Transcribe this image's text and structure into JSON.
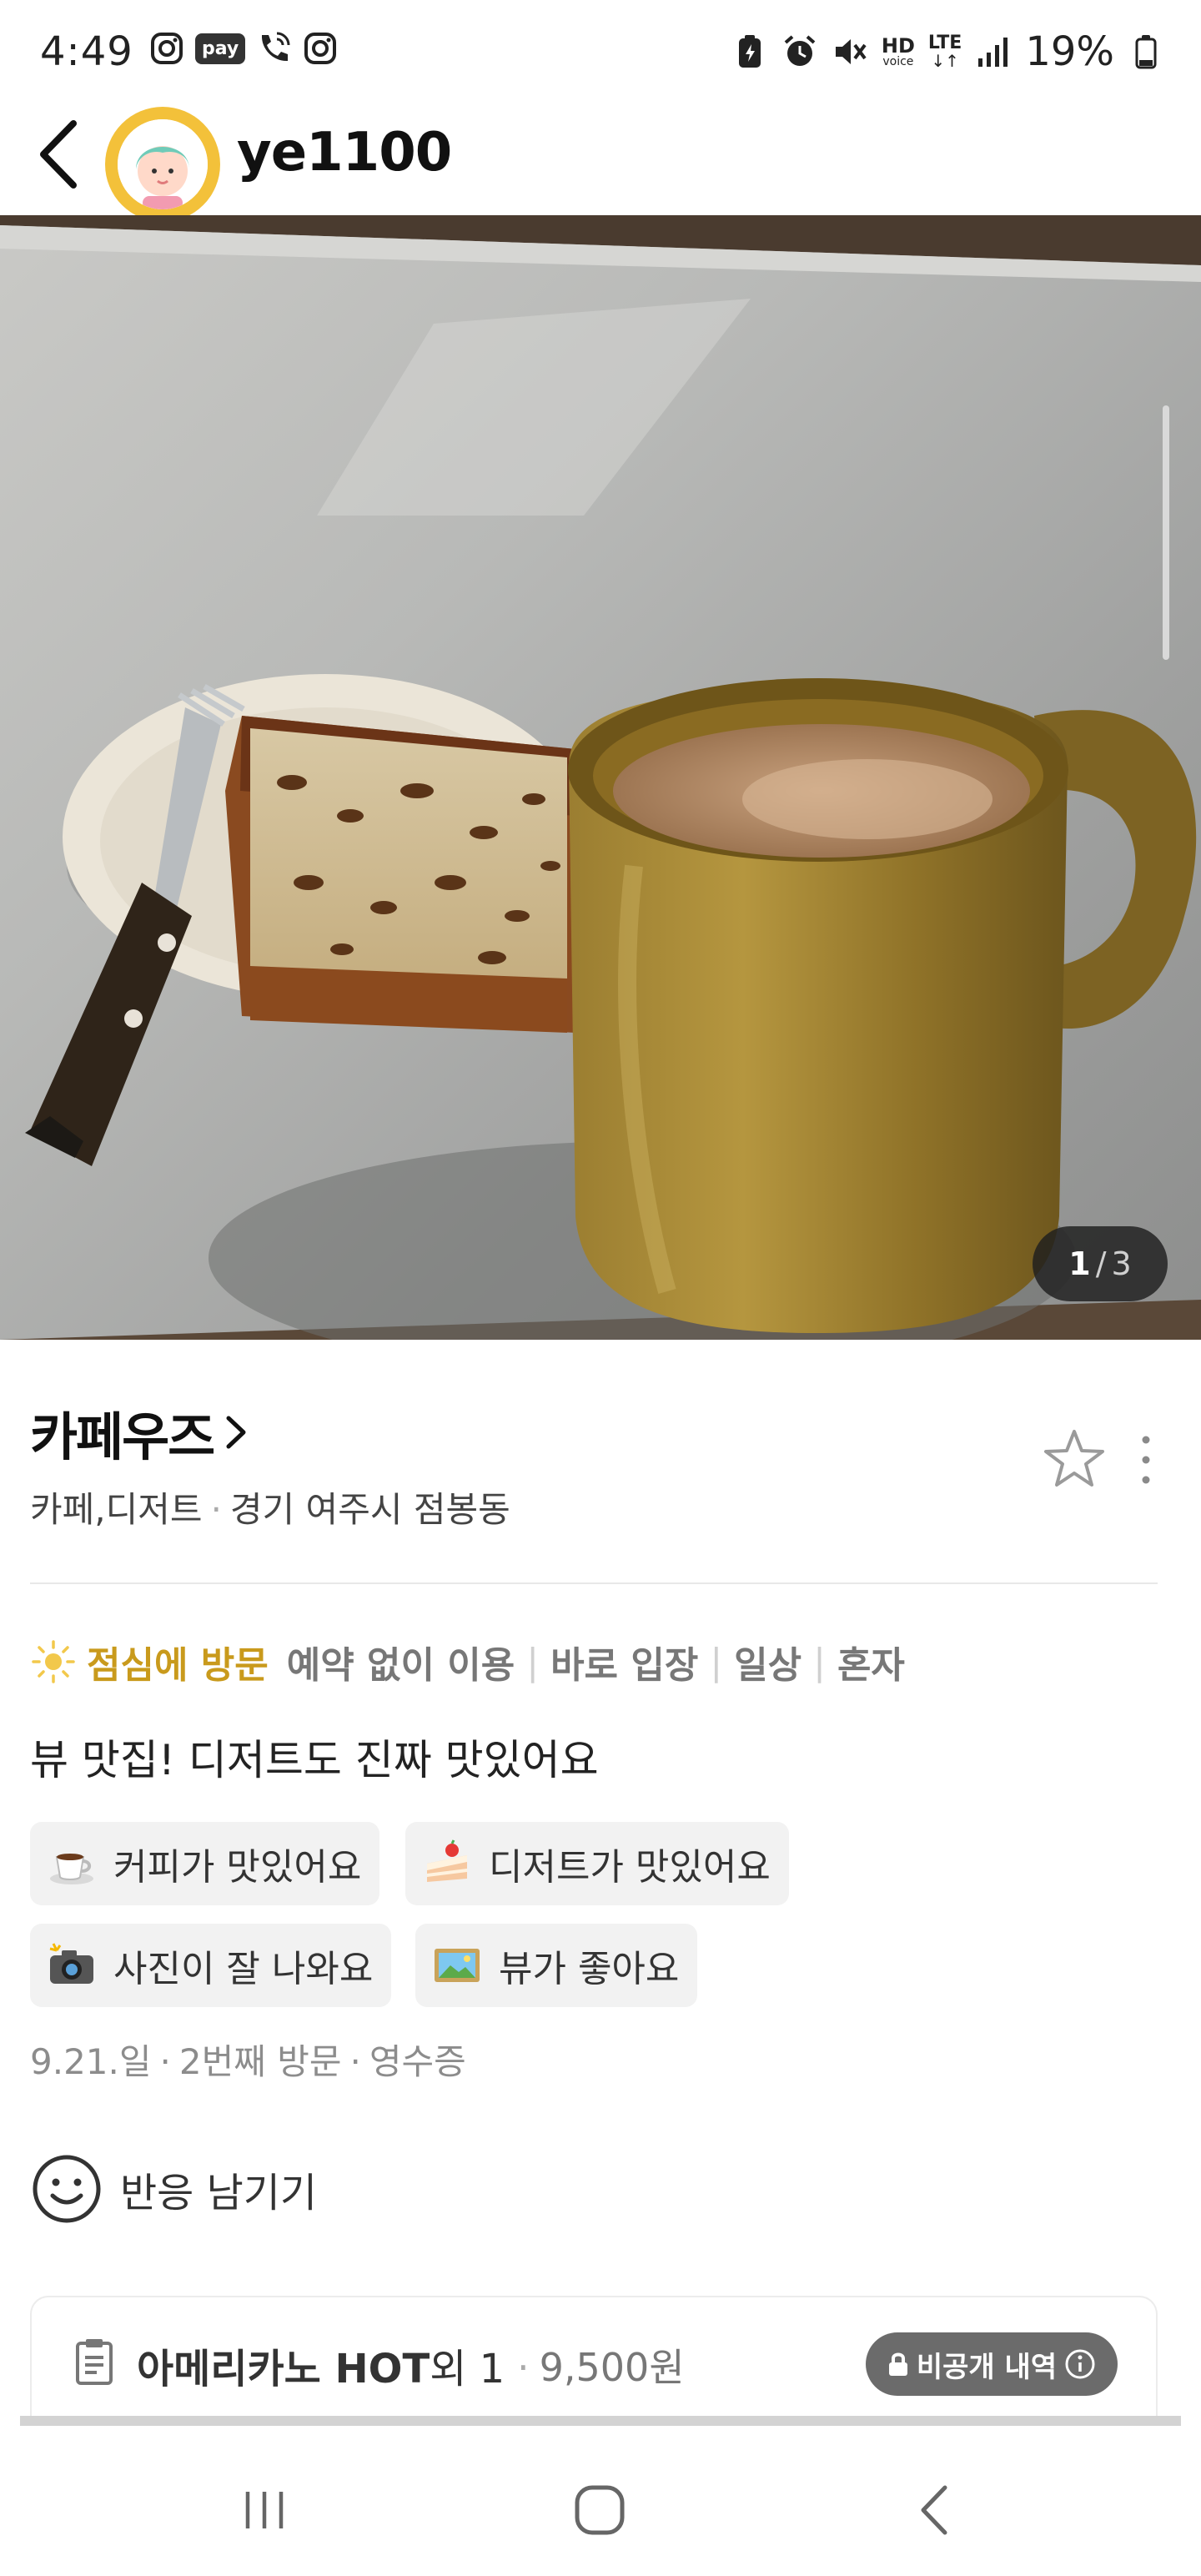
{
  "status_bar": {
    "time": "4:49",
    "pay_label": "pay",
    "network_hd": "HD",
    "network_voice": "voice",
    "network_lte": "LTE",
    "battery": "19%"
  },
  "header": {
    "username": "ye1100"
  },
  "photo": {
    "current": "1",
    "separator": "/",
    "total": "3"
  },
  "place": {
    "name": "카페우즈",
    "category": "카페,디저트",
    "location": "경기 여주시 점봉동"
  },
  "visit": {
    "time_tag": "점심에 방문",
    "tags": [
      "예약 없이 이용",
      "바로 입장",
      "일상",
      "혼자"
    ]
  },
  "review": {
    "text": "뷰 맛집! 디저트도 진짜 맛있어요",
    "keywords": [
      {
        "label": "커피가 맛있어요",
        "icon": "coffee-icon"
      },
      {
        "label": "디저트가 맛있어요",
        "icon": "cake-icon"
      },
      {
        "label": "사진이 잘 나와요",
        "icon": "camera-icon"
      },
      {
        "label": "뷰가 좋아요",
        "icon": "landscape-icon"
      }
    ],
    "date": "9.21.일",
    "visit_count": "2번째 방문",
    "verification": "영수증"
  },
  "reaction": {
    "label": "반응 남기기"
  },
  "receipt": {
    "item": "아메리카노 HOT",
    "extra": "외 1",
    "price": "9,500원",
    "private_label": "비공개 내역"
  },
  "colors": {
    "accent_time": "#c99a1c",
    "chip_bg": "#f2f2f2",
    "private_badge": "#6b6b6b"
  }
}
